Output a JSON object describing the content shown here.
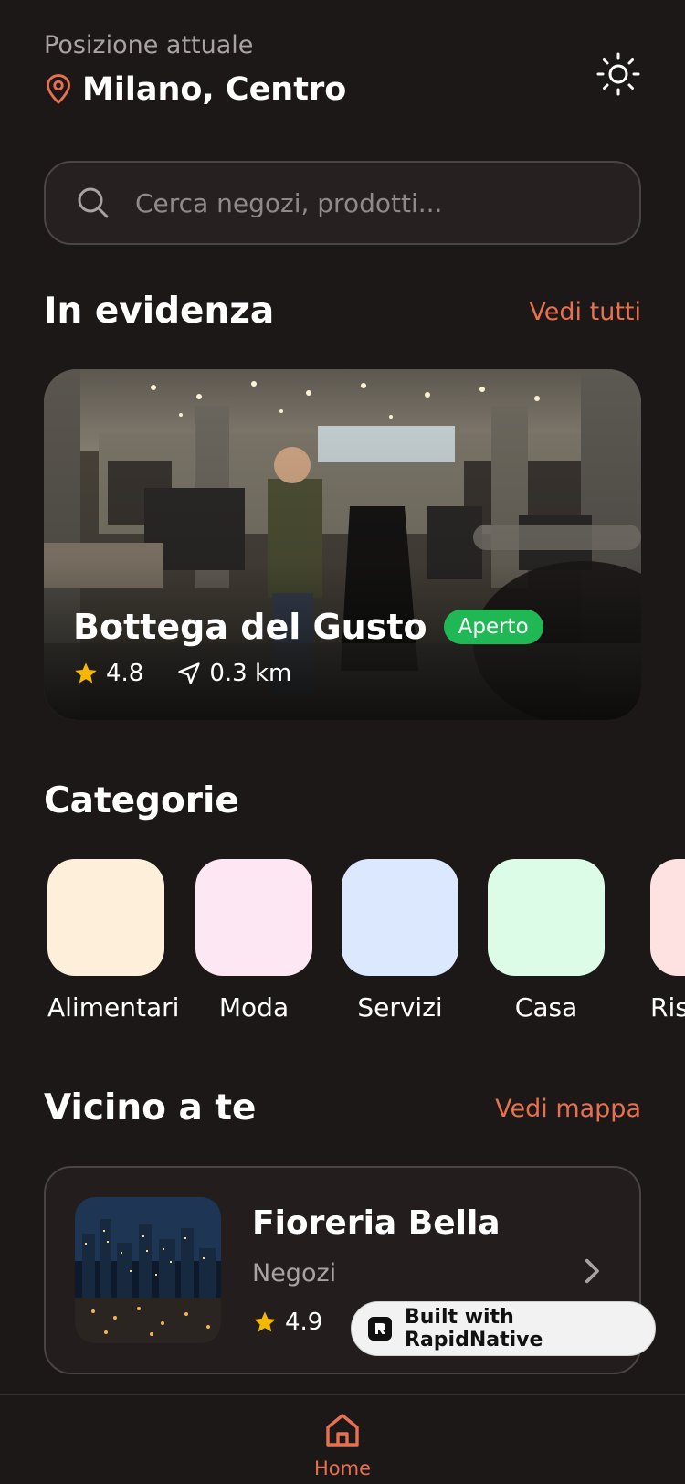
{
  "header": {
    "caption": "Posizione attuale",
    "city": "Milano, Centro",
    "theme_icon": "sun-icon",
    "pin_icon": "map-pin-icon"
  },
  "search": {
    "placeholder": "Cerca negozi, prodotti...",
    "value": "",
    "icon": "search-icon"
  },
  "featured": {
    "title": "In evidenza",
    "link": "Vedi tutti",
    "card": {
      "name": "Bottega del Gusto",
      "badge": "Aperto",
      "rating": "4.8",
      "distance": "0.3 km"
    }
  },
  "categories": {
    "title": "Categorie",
    "items": [
      {
        "label": "Alimentari",
        "color": "#fdefd9"
      },
      {
        "label": "Moda",
        "color": "#fce7f3"
      },
      {
        "label": "Servizi",
        "color": "#dbe8fe"
      },
      {
        "label": "Casa",
        "color": "#dcfce7"
      },
      {
        "label": "Ristoranti",
        "color": "#fee2e2"
      }
    ]
  },
  "nearby": {
    "title": "Vicino a te",
    "link": "Vedi mappa",
    "card": {
      "name": "Fioreria Bella",
      "category": "Negozi",
      "rating": "4.9"
    }
  },
  "built_with": {
    "label": "Built with RapidNative"
  },
  "bottom_nav": {
    "home_label": "Home"
  },
  "colors": {
    "accent": "#e8704f",
    "background": "#1c1817",
    "open_badge": "#20b855",
    "star": "#f5b800"
  }
}
